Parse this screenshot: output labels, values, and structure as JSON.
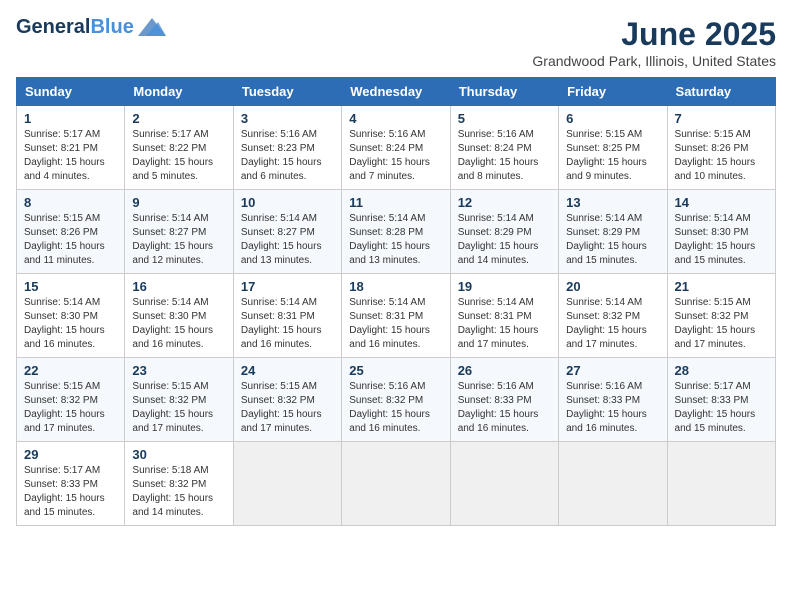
{
  "header": {
    "logo_line1": "General",
    "logo_line2": "Blue",
    "month": "June 2025",
    "location": "Grandwood Park, Illinois, United States"
  },
  "weekdays": [
    "Sunday",
    "Monday",
    "Tuesday",
    "Wednesday",
    "Thursday",
    "Friday",
    "Saturday"
  ],
  "weeks": [
    [
      {
        "day": "1",
        "sunrise": "5:17 AM",
        "sunset": "8:21 PM",
        "daylight": "15 hours and 4 minutes."
      },
      {
        "day": "2",
        "sunrise": "5:17 AM",
        "sunset": "8:22 PM",
        "daylight": "15 hours and 5 minutes."
      },
      {
        "day": "3",
        "sunrise": "5:16 AM",
        "sunset": "8:23 PM",
        "daylight": "15 hours and 6 minutes."
      },
      {
        "day": "4",
        "sunrise": "5:16 AM",
        "sunset": "8:24 PM",
        "daylight": "15 hours and 7 minutes."
      },
      {
        "day": "5",
        "sunrise": "5:16 AM",
        "sunset": "8:24 PM",
        "daylight": "15 hours and 8 minutes."
      },
      {
        "day": "6",
        "sunrise": "5:15 AM",
        "sunset": "8:25 PM",
        "daylight": "15 hours and 9 minutes."
      },
      {
        "day": "7",
        "sunrise": "5:15 AM",
        "sunset": "8:26 PM",
        "daylight": "15 hours and 10 minutes."
      }
    ],
    [
      {
        "day": "8",
        "sunrise": "5:15 AM",
        "sunset": "8:26 PM",
        "daylight": "15 hours and 11 minutes."
      },
      {
        "day": "9",
        "sunrise": "5:14 AM",
        "sunset": "8:27 PM",
        "daylight": "15 hours and 12 minutes."
      },
      {
        "day": "10",
        "sunrise": "5:14 AM",
        "sunset": "8:27 PM",
        "daylight": "15 hours and 13 minutes."
      },
      {
        "day": "11",
        "sunrise": "5:14 AM",
        "sunset": "8:28 PM",
        "daylight": "15 hours and 13 minutes."
      },
      {
        "day": "12",
        "sunrise": "5:14 AM",
        "sunset": "8:29 PM",
        "daylight": "15 hours and 14 minutes."
      },
      {
        "day": "13",
        "sunrise": "5:14 AM",
        "sunset": "8:29 PM",
        "daylight": "15 hours and 15 minutes."
      },
      {
        "day": "14",
        "sunrise": "5:14 AM",
        "sunset": "8:30 PM",
        "daylight": "15 hours and 15 minutes."
      }
    ],
    [
      {
        "day": "15",
        "sunrise": "5:14 AM",
        "sunset": "8:30 PM",
        "daylight": "15 hours and 16 minutes."
      },
      {
        "day": "16",
        "sunrise": "5:14 AM",
        "sunset": "8:30 PM",
        "daylight": "15 hours and 16 minutes."
      },
      {
        "day": "17",
        "sunrise": "5:14 AM",
        "sunset": "8:31 PM",
        "daylight": "15 hours and 16 minutes."
      },
      {
        "day": "18",
        "sunrise": "5:14 AM",
        "sunset": "8:31 PM",
        "daylight": "15 hours and 16 minutes."
      },
      {
        "day": "19",
        "sunrise": "5:14 AM",
        "sunset": "8:31 PM",
        "daylight": "15 hours and 17 minutes."
      },
      {
        "day": "20",
        "sunrise": "5:14 AM",
        "sunset": "8:32 PM",
        "daylight": "15 hours and 17 minutes."
      },
      {
        "day": "21",
        "sunrise": "5:15 AM",
        "sunset": "8:32 PM",
        "daylight": "15 hours and 17 minutes."
      }
    ],
    [
      {
        "day": "22",
        "sunrise": "5:15 AM",
        "sunset": "8:32 PM",
        "daylight": "15 hours and 17 minutes."
      },
      {
        "day": "23",
        "sunrise": "5:15 AM",
        "sunset": "8:32 PM",
        "daylight": "15 hours and 17 minutes."
      },
      {
        "day": "24",
        "sunrise": "5:15 AM",
        "sunset": "8:32 PM",
        "daylight": "15 hours and 17 minutes."
      },
      {
        "day": "25",
        "sunrise": "5:16 AM",
        "sunset": "8:32 PM",
        "daylight": "15 hours and 16 minutes."
      },
      {
        "day": "26",
        "sunrise": "5:16 AM",
        "sunset": "8:33 PM",
        "daylight": "15 hours and 16 minutes."
      },
      {
        "day": "27",
        "sunrise": "5:16 AM",
        "sunset": "8:33 PM",
        "daylight": "15 hours and 16 minutes."
      },
      {
        "day": "28",
        "sunrise": "5:17 AM",
        "sunset": "8:33 PM",
        "daylight": "15 hours and 15 minutes."
      }
    ],
    [
      {
        "day": "29",
        "sunrise": "5:17 AM",
        "sunset": "8:33 PM",
        "daylight": "15 hours and 15 minutes."
      },
      {
        "day": "30",
        "sunrise": "5:18 AM",
        "sunset": "8:32 PM",
        "daylight": "15 hours and 14 minutes."
      },
      null,
      null,
      null,
      null,
      null
    ]
  ]
}
